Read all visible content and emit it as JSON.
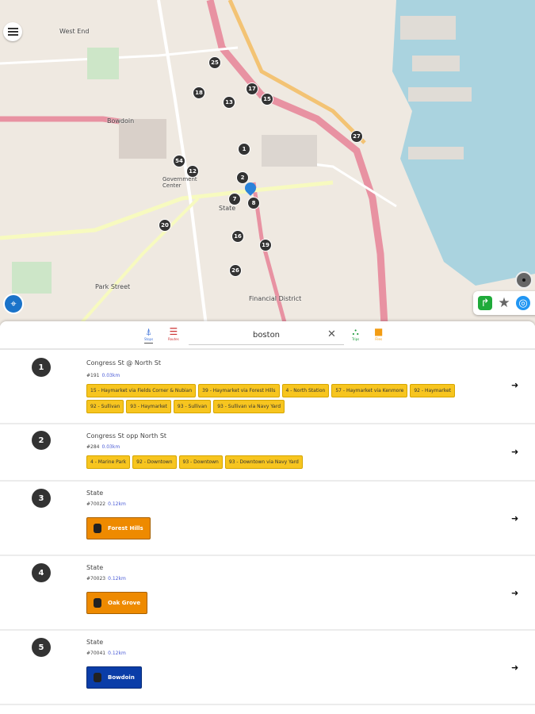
{
  "map": {
    "labels": [
      "West End",
      "Bowdoin",
      "Government Center",
      "State",
      "Park Street",
      "Financial District"
    ],
    "markers": [
      "25",
      "18",
      "13",
      "17",
      "15",
      "27",
      "1",
      "54",
      "12",
      "2",
      "7",
      "8",
      "20",
      "16",
      "19",
      "26"
    ],
    "menu_icon": "hamburger-icon",
    "locate_icon": "gps-icon",
    "tools": [
      "directions-icon",
      "star-icon",
      "my-location-icon"
    ]
  },
  "tabs": {
    "stops": "Stops",
    "routes": "Routes",
    "trips": "Trips",
    "files": "Files"
  },
  "search": {
    "value": "boston"
  },
  "colors": {
    "bus": "#f7c51f",
    "orange_line": "#ee8a00",
    "blue_line": "#0a3da8"
  },
  "results": [
    {
      "n": "1",
      "name": "Congress St @ North St",
      "code": "#191",
      "dist": "0.03km",
      "chips": [
        "15 - Haymarket via Fields Corner & Nubian",
        "39 - Haymarket via Forest Hills",
        "4 - North Station",
        "57 - Haymarket via Kenmore",
        "92 - Haymarket",
        "92 - Sullivan",
        "93 - Haymarket",
        "93 - Sullivan",
        "93 - Sullivan via Navy Yard"
      ]
    },
    {
      "n": "2",
      "name": "Congress St opp North St",
      "code": "#284",
      "dist": "0.03km",
      "chips": [
        "4 - Marine Park",
        "92 - Downtown",
        "93 - Downtown",
        "93 - Downtown via Navy Yard"
      ]
    },
    {
      "n": "3",
      "name": "State",
      "code": "#70022",
      "dist": "0.12km",
      "sub": "Forest Hills",
      "color": "#ee8a00"
    },
    {
      "n": "4",
      "name": "State",
      "code": "#70023",
      "dist": "0.12km",
      "sub": "Oak Grove",
      "color": "#ee8a00"
    },
    {
      "n": "5",
      "name": "State",
      "code": "#70041",
      "dist": "0.12km",
      "sub": "Bowdoin",
      "color": "#0a3da8"
    }
  ]
}
